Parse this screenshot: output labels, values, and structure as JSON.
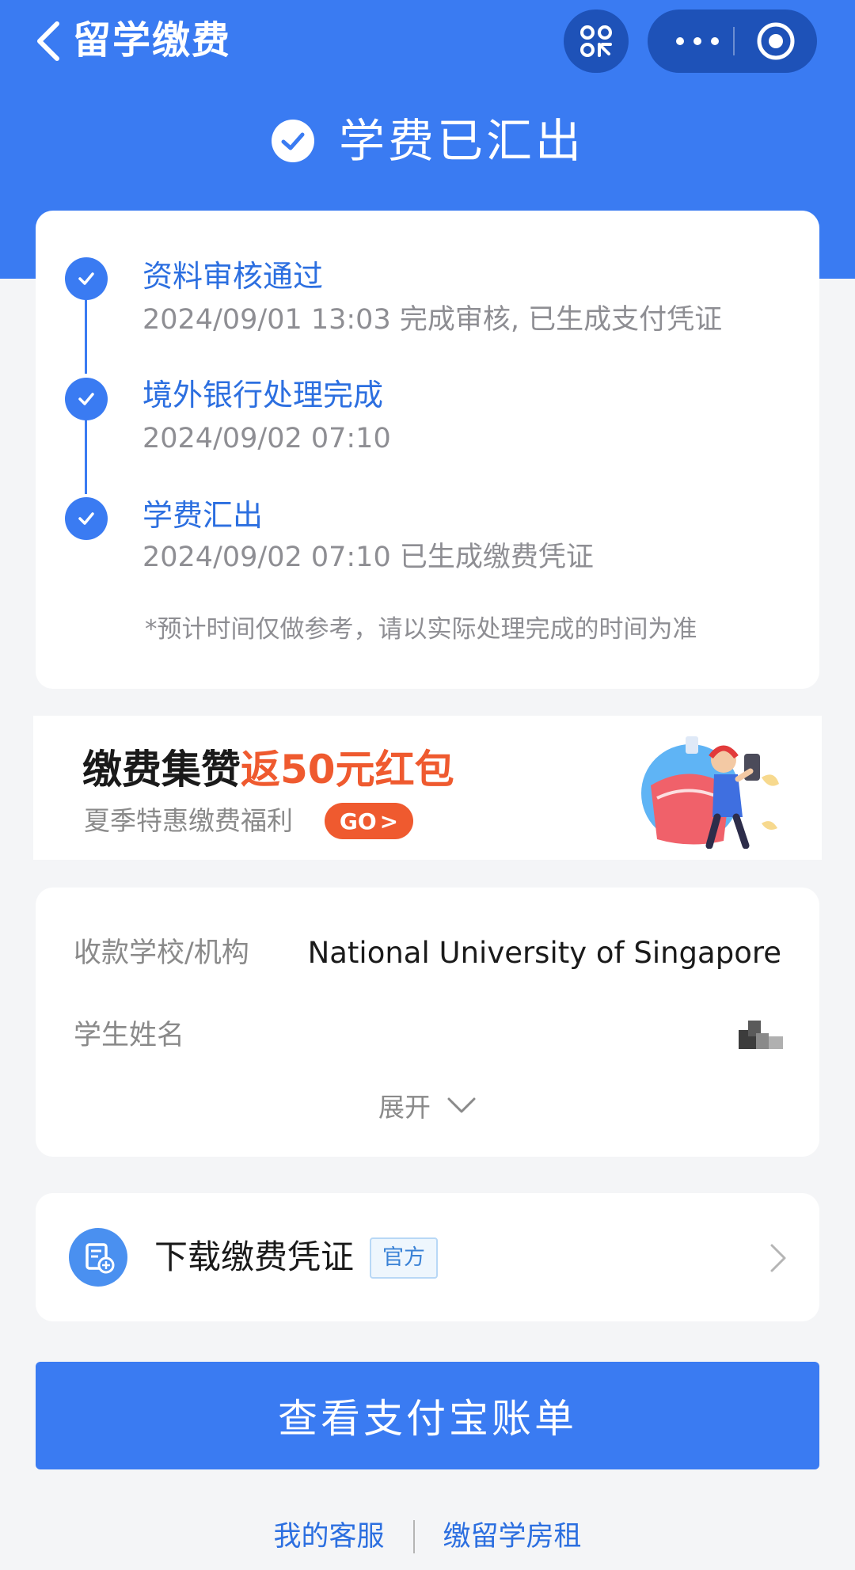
{
  "nav": {
    "title": "留学缴费"
  },
  "status": {
    "text": "学费已汇出"
  },
  "timeline": {
    "steps": [
      {
        "title": "资料审核通过",
        "desc": "2024/09/01 13:03 完成审核, 已生成支付凭证"
      },
      {
        "title": "境外银行处理完成",
        "desc": "2024/09/02 07:10"
      },
      {
        "title": "学费汇出",
        "desc": "2024/09/02 07:10 已生成缴费凭证"
      }
    ],
    "note": "*预计时间仅做参考，请以实际处理完成的时间为准"
  },
  "promo": {
    "title_main": "缴费集赞",
    "title_highlight": "返50元红包",
    "subtitle": "夏季特惠缴费福利",
    "go_label": "GO",
    "go_arrow": ">"
  },
  "info": {
    "school_label": "收款学校/机构",
    "school_value": "National University of Singapore",
    "student_label": "学生姓名",
    "expand_label": "展开"
  },
  "download": {
    "label": "下载缴费凭证",
    "tag": "官方"
  },
  "primary_button": {
    "label": "查看支付宝账单"
  },
  "footer": {
    "link1": "我的客服",
    "link2": "缴留学房租"
  },
  "colors": {
    "brand_blue": "#3a7bf2",
    "promo_orange": "#ef5a2f"
  },
  "icons": {
    "back": "chevron-left-icon",
    "scan": "qr-scan-icon",
    "more": "more-icon",
    "close": "close-circle-icon",
    "status": "check-circle-icon",
    "expand": "chevron-down-icon",
    "download": "receipt-icon",
    "row_arrow": "chevron-right-icon"
  }
}
